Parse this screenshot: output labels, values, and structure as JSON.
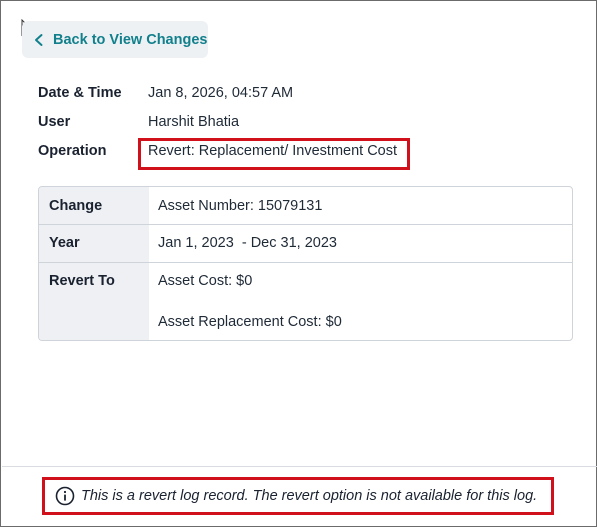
{
  "back_button": {
    "label": "Back to View Changes"
  },
  "details": {
    "date_time_label": "Date & Time",
    "date_time_value": "Jan 8, 2026, 04:57 AM",
    "user_label": "User",
    "user_value": "Harshit Bhatia",
    "operation_label": "Operation",
    "operation_value": "Revert: Replacement/ Investment Cost"
  },
  "change_table": {
    "change_label": "Change",
    "change_value": "Asset Number: 15079131",
    "year_label": "Year",
    "year_value": "Jan 1, 2023  - Dec 31, 2023",
    "revert_label": "Revert To",
    "revert_values": [
      "Asset Cost: $0",
      "Asset Replacement Cost: $0"
    ]
  },
  "notice": {
    "text": "This is a revert log record. The revert option is not available for this log."
  },
  "colors": {
    "accent": "#11808c",
    "highlight": "#d0101a",
    "label_bg": "#eef0f3"
  }
}
